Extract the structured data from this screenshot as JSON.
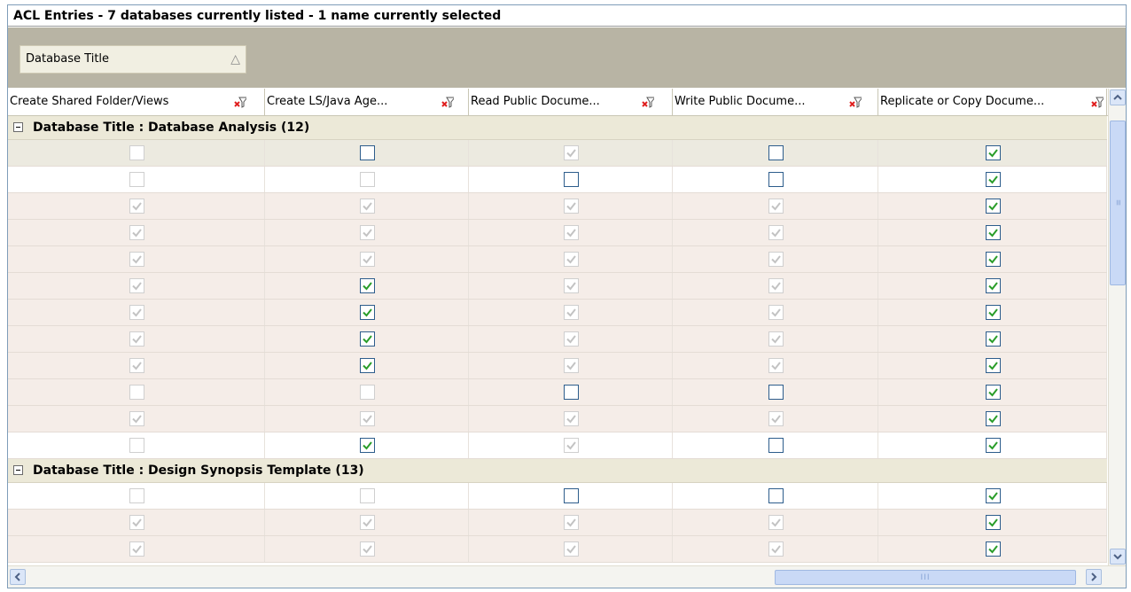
{
  "window": {
    "title": "ACL Entries - 7 databases currently listed - 1 name currently selected"
  },
  "grouping": {
    "chip_label": "Database Title",
    "sort_indicator": "ascending-triangle-icon"
  },
  "columns": [
    {
      "label": "Create Shared Folder/Views"
    },
    {
      "label": "Create LS/Java Age..."
    },
    {
      "label": "Read Public Docume..."
    },
    {
      "label": "Write Public Docume..."
    },
    {
      "label": "Replicate or Copy Docume..."
    }
  ],
  "colors": {
    "check_green": "#2a9d2a",
    "check_disabled": "#c3c3c3",
    "filter_red": "#e02020",
    "group_row_bg": "#ece9d8",
    "alt_row_bg": "#f5ede8"
  },
  "groups": [
    {
      "label": "Database Title : Database Analysis (12)",
      "rows": [
        {
          "style": "sel",
          "cells": [
            [
              "d",
              0
            ],
            [
              "e",
              0
            ],
            [
              "d",
              1
            ],
            [
              "e",
              0
            ],
            [
              "e",
              1
            ]
          ]
        },
        {
          "style": "plain",
          "cells": [
            [
              "d",
              0
            ],
            [
              "d",
              0
            ],
            [
              "e",
              0
            ],
            [
              "e",
              0
            ],
            [
              "e",
              1
            ]
          ]
        },
        {
          "style": "alt",
          "cells": [
            [
              "d",
              1
            ],
            [
              "d",
              1
            ],
            [
              "d",
              1
            ],
            [
              "d",
              1
            ],
            [
              "e",
              1
            ]
          ]
        },
        {
          "style": "alt",
          "cells": [
            [
              "d",
              1
            ],
            [
              "d",
              1
            ],
            [
              "d",
              1
            ],
            [
              "d",
              1
            ],
            [
              "e",
              1
            ]
          ]
        },
        {
          "style": "alt",
          "cells": [
            [
              "d",
              1
            ],
            [
              "d",
              1
            ],
            [
              "d",
              1
            ],
            [
              "d",
              1
            ],
            [
              "e",
              1
            ]
          ]
        },
        {
          "style": "alt",
          "cells": [
            [
              "d",
              1
            ],
            [
              "e",
              1
            ],
            [
              "d",
              1
            ],
            [
              "d",
              1
            ],
            [
              "e",
              1
            ]
          ]
        },
        {
          "style": "alt",
          "cells": [
            [
              "d",
              1
            ],
            [
              "e",
              1
            ],
            [
              "d",
              1
            ],
            [
              "d",
              1
            ],
            [
              "e",
              1
            ]
          ]
        },
        {
          "style": "alt",
          "cells": [
            [
              "d",
              1
            ],
            [
              "e",
              1
            ],
            [
              "d",
              1
            ],
            [
              "d",
              1
            ],
            [
              "e",
              1
            ]
          ]
        },
        {
          "style": "alt",
          "cells": [
            [
              "d",
              1
            ],
            [
              "e",
              1
            ],
            [
              "d",
              1
            ],
            [
              "d",
              1
            ],
            [
              "e",
              1
            ]
          ]
        },
        {
          "style": "alt",
          "cells": [
            [
              "d",
              0
            ],
            [
              "d",
              0
            ],
            [
              "e",
              0
            ],
            [
              "e",
              0
            ],
            [
              "e",
              1
            ]
          ]
        },
        {
          "style": "alt",
          "cells": [
            [
              "d",
              1
            ],
            [
              "d",
              1
            ],
            [
              "d",
              1
            ],
            [
              "d",
              1
            ],
            [
              "e",
              1
            ]
          ]
        },
        {
          "style": "plain",
          "cells": [
            [
              "d",
              0
            ],
            [
              "e",
              1
            ],
            [
              "d",
              1
            ],
            [
              "e",
              0
            ],
            [
              "e",
              1
            ]
          ]
        }
      ]
    },
    {
      "label": "Database Title : Design Synopsis Template (13)",
      "rows": [
        {
          "style": "plain",
          "cells": [
            [
              "d",
              0
            ],
            [
              "d",
              0
            ],
            [
              "e",
              0
            ],
            [
              "e",
              0
            ],
            [
              "e",
              1
            ]
          ]
        },
        {
          "style": "alt",
          "cells": [
            [
              "d",
              1
            ],
            [
              "d",
              1
            ],
            [
              "d",
              1
            ],
            [
              "d",
              1
            ],
            [
              "e",
              1
            ]
          ]
        },
        {
          "style": "alt",
          "cells": [
            [
              "d",
              1
            ],
            [
              "d",
              1
            ],
            [
              "d",
              1
            ],
            [
              "d",
              1
            ],
            [
              "e",
              1
            ]
          ]
        }
      ]
    }
  ]
}
